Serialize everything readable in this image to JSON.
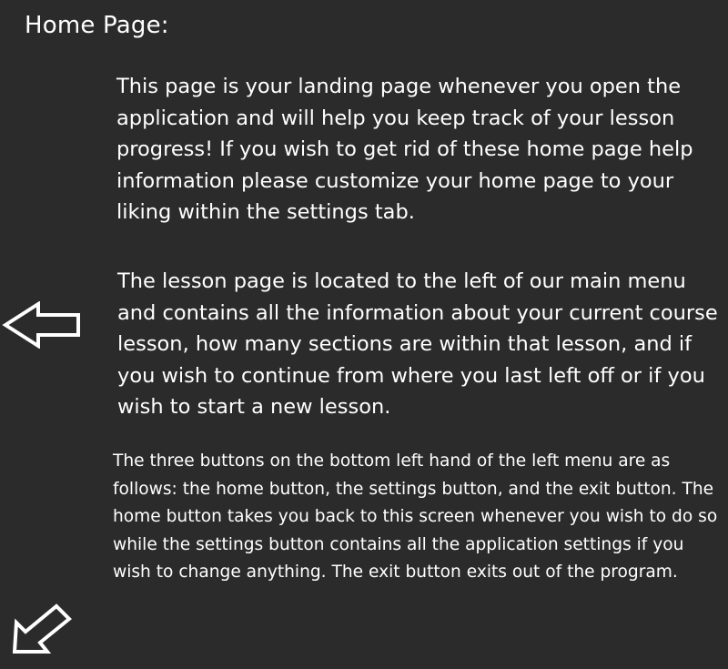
{
  "page": {
    "title": "Home Page:"
  },
  "content": {
    "paragraph_landing": "This page is your landing page whenever you open the application and will help you keep track of your lesson progress! If you wish to get rid of these home page help information please customize your home page to your liking within the settings tab.",
    "paragraph_lesson": "The lesson page is located to the left of our main menu and contains all the information about your current course lesson, how many sections are within that lesson, and if you wish to continue from where you last left off or if you wish to start a new lesson.",
    "paragraph_buttons": "The three buttons on the bottom left hand of the left menu are as follows: the home button, the settings button, and the exit button. The home button takes you back to this screen whenever you wish to do so while the settings button contains all the application settings if you wish to change anything. The exit button exits out of the program."
  },
  "icons": {
    "left_arrow": "arrow-left-outline-icon",
    "down_left_arrow": "arrow-down-left-outline-icon"
  },
  "colors": {
    "background": "#2b2b2b",
    "text": "#ffffff"
  }
}
